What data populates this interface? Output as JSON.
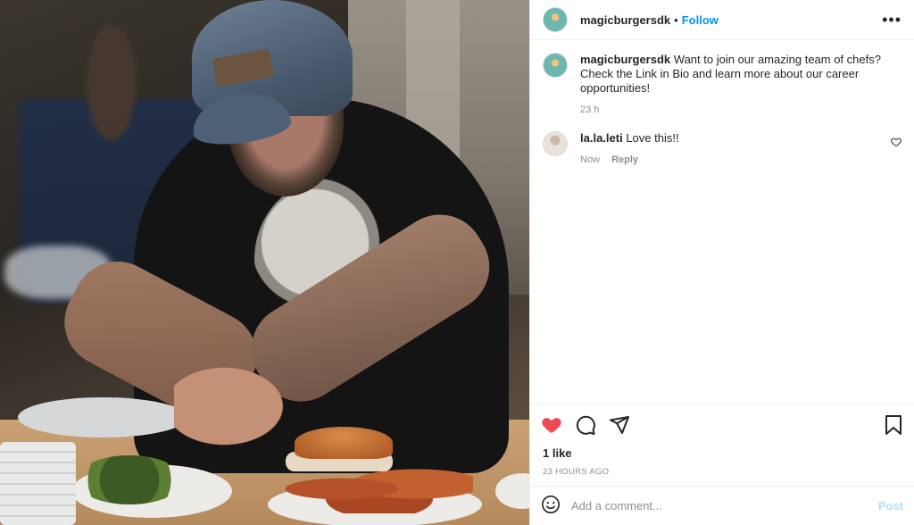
{
  "post": {
    "username": "magicburgersdk",
    "follow_label": "Follow",
    "separator": "•",
    "more_label": "•••"
  },
  "caption": {
    "username": "magicburgersdk",
    "text": "Want to join our amazing team of chefs? Check the Link in Bio and learn more about our career opportunities!",
    "time": "23 h"
  },
  "comments": [
    {
      "username": "la.la.leti",
      "text": "Love this!!",
      "time": "Now",
      "reply_label": "Reply"
    }
  ],
  "engagement": {
    "likes": "1 like",
    "timestamp": "23 HOURS AGO",
    "liked": true,
    "like_color": "#ed4956"
  },
  "add_comment": {
    "placeholder": "Add a comment...",
    "post_label": "Post"
  },
  "icons": {
    "like": "heart-icon",
    "comment": "comment-bubble-icon",
    "share": "paper-plane-icon",
    "save": "bookmark-icon",
    "emoji": "emoji-icon",
    "more": "more-options-icon"
  },
  "colors": {
    "link_blue": "#0095f6",
    "post_disabled": "#b2dffc",
    "muted": "#8e8e8e"
  }
}
